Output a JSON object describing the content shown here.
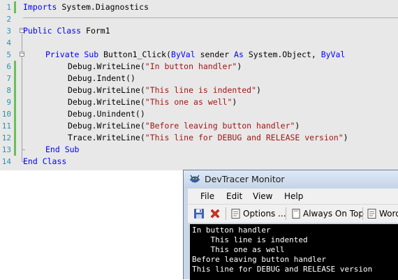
{
  "editor": {
    "line_numbers": [
      "1",
      "2",
      "3",
      "4",
      "5",
      "6",
      "7",
      "8",
      "9",
      "10",
      "11",
      "12",
      "13",
      "14"
    ],
    "lines": {
      "l1": {
        "kw": "Imports",
        "rest": " System.Diagnostics"
      },
      "l3": {
        "kw": "Public Class",
        "rest": " Form1"
      },
      "l5": {
        "kw1": "Private Sub",
        "mid1": " Button1_Click(",
        "kw2": "ByVal",
        "mid2": " sender ",
        "kw3": "As",
        "mid3": " System.Object, ",
        "kw4": "ByVal"
      },
      "l6": {
        "pre": "Debug.WriteLine(",
        "str": "\"In button handler\"",
        "post": ")"
      },
      "l7": {
        "pre": "Debug.Indent()"
      },
      "l8": {
        "pre": "Debug.WriteLine(",
        "str": "\"This line is indented\"",
        "post": ")"
      },
      "l9": {
        "pre": "Debug.WriteLine(",
        "str": "\"This one as well\"",
        "post": ")"
      },
      "l10": {
        "pre": "Debug.Unindent()"
      },
      "l11": {
        "pre": "Debug.WriteLine(",
        "str": "\"Before leaving button handler\"",
        "post": ")"
      },
      "l12": {
        "pre": "Trace.WriteLine(",
        "str": "\"This line for DEBUG and RELEASE version\"",
        "post": ")"
      },
      "l13": {
        "kw": "End Sub"
      },
      "l14": {
        "kw": "End Class"
      }
    }
  },
  "tracer": {
    "title": "DevTracer Monitor",
    "menu": [
      "File",
      "Edit",
      "View",
      "Help"
    ],
    "toolbar": {
      "options": "Options ...",
      "always_on_top": "Always On Top",
      "word": "Word"
    },
    "output_lines": [
      "In button handler",
      "    This line is indented",
      "    This one as well",
      "Before leaving button handler",
      "This line for DEBUG and RELEASE version"
    ]
  }
}
